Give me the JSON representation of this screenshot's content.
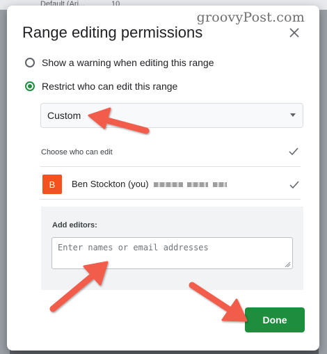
{
  "background": {
    "toolbar_font": "Default (Ari...",
    "toolbar_size": "10"
  },
  "watermark": "groovyPost.com",
  "dialog": {
    "title": "Range editing permissions",
    "options": [
      {
        "label": "Show a warning when editing this range",
        "checked": false
      },
      {
        "label": "Restrict who can edit this range",
        "checked": true
      }
    ],
    "select": {
      "value": "Custom"
    },
    "choose_label": "Choose who can edit",
    "user": {
      "initial": "B",
      "name": "Ben Stockton (you)"
    },
    "add_editors": {
      "label": "Add editors:",
      "placeholder": "Enter names or email addresses"
    },
    "done_label": "Done"
  },
  "colors": {
    "accent_green": "#1e8e3e",
    "avatar_orange": "#f4511e",
    "arrow_red": "#f15b4c"
  },
  "icons": [
    "close-icon",
    "chevron-down-icon",
    "checkmark-icon",
    "resize-handle-icon",
    "arrow-annotation"
  ]
}
